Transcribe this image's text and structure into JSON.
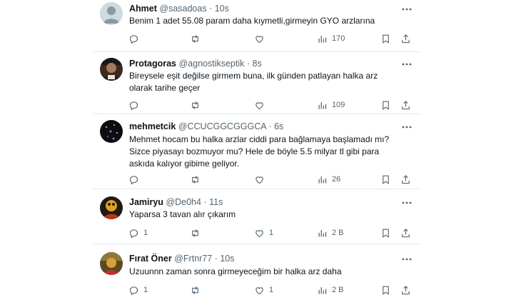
{
  "colors": {
    "text": "#0f1419",
    "muted": "#536471",
    "divider": "#e7e9ec"
  },
  "icons": [
    "more-icon",
    "reply-icon",
    "retweet-icon",
    "like-icon",
    "views-icon",
    "bookmark-icon",
    "share-icon"
  ],
  "tweets": [
    {
      "name": "Ahmet",
      "handle": "@sasadoas",
      "dot": "·",
      "time": "10s",
      "text": "Benim 1 adet 55.08 param  daha kıymetli,girmeyin GYO arzlarına",
      "replies": "",
      "retweets": "",
      "likes": "",
      "views": "170"
    },
    {
      "name": "Protagoras",
      "handle": "@agnostikseptik",
      "dot": "·",
      "time": "8s",
      "text": "Bireysele eşit değilse girmem buna, ilk günden patlayan halka arz olarak tarihe geçer",
      "replies": "",
      "retweets": "",
      "likes": "",
      "views": "109"
    },
    {
      "name": "mehmetcik",
      "handle": "@CCUCGGCGGGCA",
      "dot": "·",
      "time": "6s",
      "text": "Mehmet hocam bu halka arzlar ciddi para bağlamaya başlamadı mı? Sizce piyasayı bozmuyor mu? Hele de böyle 5.5 milyar tl gibi para askıda kalıyor gibime geliyor.",
      "replies": "",
      "retweets": "",
      "likes": "",
      "views": "26"
    },
    {
      "name": "Jamiryu",
      "handle": "@De0h4",
      "dot": "·",
      "time": "11s",
      "text": "Yaparsa 3 tavan alır çıkarım",
      "replies": "1",
      "retweets": "",
      "likes": "1",
      "views": "2 B"
    },
    {
      "name": "Fırat Öner",
      "handle": "@Frtnr77",
      "dot": "·",
      "time": "10s",
      "text": "Uzuunnn zaman sonra girmeyeceğim bir halka arz daha",
      "replies": "1",
      "retweets": "",
      "likes": "1",
      "views": "2 B"
    }
  ]
}
